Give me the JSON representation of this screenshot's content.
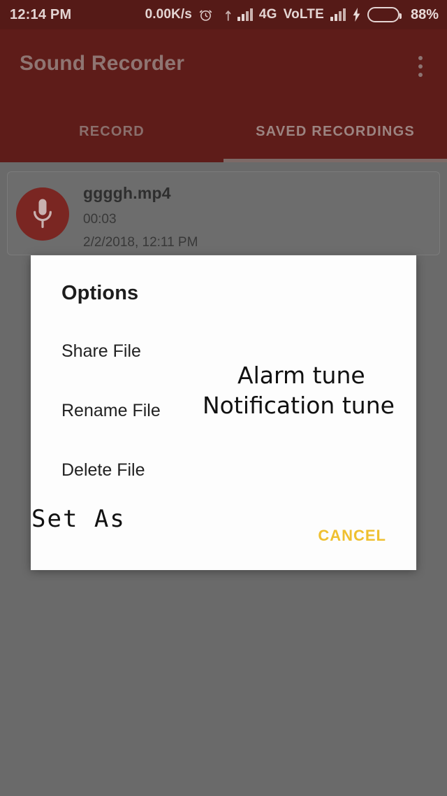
{
  "statusbar": {
    "clock": "12:14 PM",
    "net_speed": "0.00K/s",
    "alarm_icon": "alarm-clock-icon",
    "sync_icon": "data-transfer-icon",
    "signal_icon_1": "signal-bars-icon",
    "network_type": "4G",
    "volte": "VoLTE",
    "signal_icon_2": "signal-bars-icon",
    "charging_icon": "lightning-bolt-icon",
    "battery_icon": "battery-icon",
    "battery_percent": "88%",
    "battery_level": 88,
    "battery_color": "#62c31b"
  },
  "appbar": {
    "title": "Sound Recorder",
    "overflow_label": "overflow-menu",
    "background": "#5e1c19",
    "tabs": [
      {
        "label": "RECORD",
        "active": false
      },
      {
        "label": "SAVED RECORDINGS",
        "active": true
      }
    ]
  },
  "recording": {
    "mic_icon": "microphone-icon",
    "name": "ggggh.mp4",
    "duration": "00:03",
    "date": "2/2/2018, 12:11 PM"
  },
  "dialog": {
    "title": "Options",
    "items": [
      {
        "label": "Share File"
      },
      {
        "label": "Rename File"
      },
      {
        "label": "Delete File"
      }
    ],
    "set_as": "Set As",
    "tunes": [
      {
        "label": "Alarm tune"
      },
      {
        "label": "Notification tune"
      }
    ],
    "cancel": "CANCEL",
    "cancel_color": "#efc030"
  }
}
